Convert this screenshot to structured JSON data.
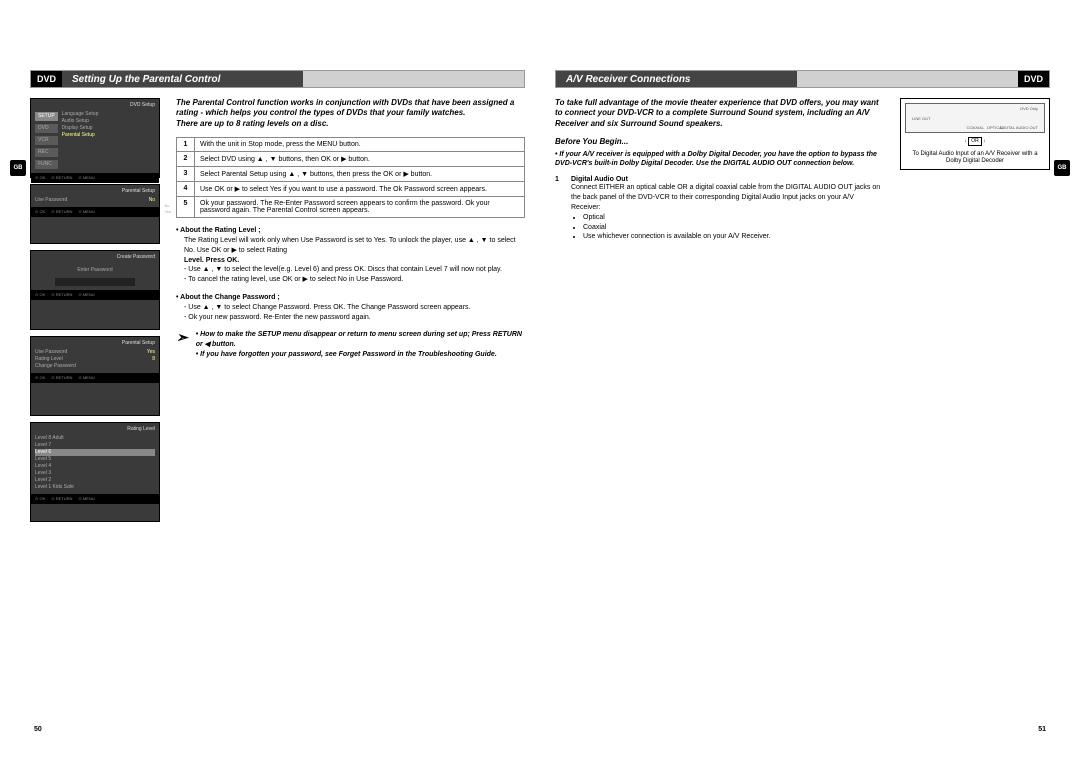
{
  "left": {
    "badge": "DVD",
    "title": "Setting Up the Parental Control",
    "gb": "GB",
    "intro": "The Parental Control function works in conjunction with DVDs that have been assigned a rating - which helps you control the types of DVDs that your family watches.\nThere are up to 8 rating levels on a disc.",
    "steps": [
      {
        "n": "1",
        "t": "With the unit in Stop mode, press the MENU button."
      },
      {
        "n": "2",
        "t": "Select DVD using ▲ , ▼ buttons, then OK or ▶ button."
      },
      {
        "n": "3",
        "t": "Select Parental Setup using ▲ , ▼ buttons, then press the OK or ▶ button."
      },
      {
        "n": "4",
        "t": "Use OK or ▶ to select Yes if you want to use a password. The Ok Password screen appears."
      },
      {
        "n": "5",
        "t": "Ok your password. The Re-Enter Password screen appears to confirm the password. Ok your password again. The Parental Control screen appears."
      }
    ],
    "about_rating_title": "• About the Rating Level ;",
    "about_rating_body1": "The Rating Level will work only when Use Password is set to Yes. To unlock the player, use ▲ , ▼ to select No. Use OK or ▶ to select Rating",
    "about_rating_body2": "Level. Press OK.",
    "about_rating_li1": "- Use ▲ , ▼ to select the level(e.g. Level 6) and press OK. Discs that contain Level 7 will now not play.",
    "about_rating_li2": "- To cancel the rating level, use OK or ▶ to select No in Use Password.",
    "about_change_title": "• About the Change Password ;",
    "about_change_li1": "- Use ▲ , ▼ to select Change Password. Press OK. The Change Password screen appears.",
    "about_change_li2": "- Ok your new password. Re-Enter the new password again.",
    "note1": "• How to make the SETUP menu disappear or return to menu screen during set up; Press RETURN or ◀ button.",
    "note2": "• If you have forgotten your password, see Forget Password in the Troubleshooting Guide.",
    "shots": {
      "s1_title": "DVD Setup",
      "s1_items": [
        "Language Setup",
        "Audio Setup",
        "Display Setup",
        "Parental Setup"
      ],
      "s1_side": [
        "SETUP",
        "DVD",
        "VCR",
        "REC",
        "FUNC"
      ],
      "s2_title": "Parental Setup",
      "s2_row": "Use Password",
      "s2_val": "No",
      "s2_opts": "No\nYes",
      "s3_title": "Create Password",
      "s3_label": "Enter Password",
      "s4_title": "Parental Setup",
      "s4_rows": [
        "Use Password",
        "Rating Level",
        "Change Password"
      ],
      "s4_vals": [
        "Yes",
        "8"
      ],
      "s5_title": "Rating Level",
      "s5_levels": [
        "Level 8 Adult",
        "Level 7",
        "Level 6",
        "Level 5",
        "Level 4",
        "Level 3",
        "Level 2",
        "Level 1 Kids Safe"
      ],
      "footer": [
        "⊙ OK",
        "⊙ RETURN",
        "⊙ MENU"
      ]
    },
    "pagenum": "50"
  },
  "right": {
    "title": "A/V Receiver Connections",
    "badge": "DVD",
    "gb": "GB",
    "intro": "To take full advantage of the movie theater experience that DVD offers, you may want to connect your DVD-VCR to a complete Surround Sound system, including an A/V Receiver and six Surround Sound speakers.",
    "before": "Before You Begin...",
    "bullet": "• If your A/V receiver is equipped with a Dolby Digital Decoder, you have the option to bypass the DVD-VCR's built-in Dolby Digital Decoder. Use the DIGITAL AUDIO OUT connection below.",
    "sec_num": "1",
    "sec_title": "Digital Audio Out",
    "sec_body": "Connect EITHER an optical cable OR a digital coaxial cable from the DIGITAL AUDIO OUT jacks on the back panel of the DVD-VCR to their corresponding Digital Audio Input jacks on your A/V Receiver:",
    "sec_li1": "Optical",
    "sec_li2": "Coaxial",
    "sec_li3": "Use whichever connection is available on your A/V Receiver.",
    "diag": {
      "dvd_only": "DVD Only",
      "line_out": "LINE OUT",
      "digital_audio_out": "DIGITAL AUDIO OUT",
      "coaxial": "COAXIAL",
      "optical": "OPTICAL",
      "or": "OR",
      "caption": "To Digital Audio Input of an A/V Receiver with a Dolby Digital Decoder"
    },
    "pagenum": "51"
  }
}
